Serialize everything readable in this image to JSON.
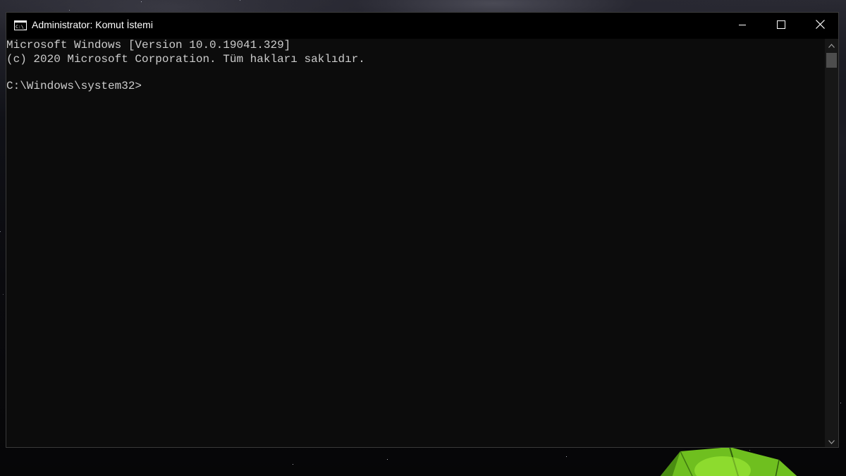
{
  "window": {
    "title": "Administrator: Komut İstemi",
    "icon": "cmd-icon"
  },
  "caption_buttons": {
    "minimize_icon": "minimize-icon",
    "maximize_icon": "maximize-icon",
    "close_icon": "close-icon"
  },
  "console": {
    "lines": [
      "Microsoft Windows [Version 10.0.19041.329]",
      "(c) 2020 Microsoft Corporation. Tüm hakları saklıdır.",
      "C:\\Windows\\system32>"
    ],
    "text_color": "#cccccc",
    "background_color": "#0c0c0c"
  },
  "scrollbar": {
    "up_icon": "chevron-up-icon",
    "down_icon": "chevron-down-icon"
  },
  "wallpaper": {
    "description_icon": "night-sky-tent-wallpaper",
    "tent_color": "#7ed321"
  }
}
